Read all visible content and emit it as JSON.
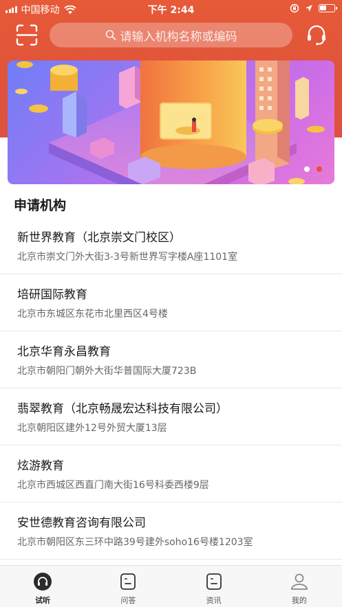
{
  "status_bar": {
    "carrier": "中国移动",
    "time": "下午 2:44"
  },
  "header": {
    "search": {
      "placeholder": "请输入机构名称或编码"
    }
  },
  "colors": {
    "accent": "#e25336",
    "header_bg": "#e0533a"
  },
  "banner": {
    "slide_count": 2,
    "active_slide": 1
  },
  "section": {
    "title": "申请机构"
  },
  "organizations": [
    {
      "name": "新世界教育（北京崇文门校区）",
      "address": "北京市崇文门外大街3-3号新世界写字楼A座1101室"
    },
    {
      "name": "培研国际教育",
      "address": "北京市东城区东花市北里西区4号楼"
    },
    {
      "name": "北京华育永昌教育",
      "address": "北京市朝阳门朝外大街华普国际大厦723B"
    },
    {
      "name": "翡翠教育（北京畅晟宏达科技有限公司）",
      "address": "北京朝阳区建外12号外贸大厦13层"
    },
    {
      "name": "炫游教育",
      "address": "北京市西城区西直门南大街16号科委西楼9层"
    },
    {
      "name": "安世德教育咨询有限公司",
      "address": "北京市朝阳区东三环中路39号建外soho16号楼1203室"
    }
  ],
  "tabs": [
    {
      "label": "试听",
      "icon": "headphones-icon",
      "active": true
    },
    {
      "label": "问答",
      "icon": "qa-icon",
      "active": false
    },
    {
      "label": "资讯",
      "icon": "news-icon",
      "active": false
    },
    {
      "label": "我的",
      "icon": "person-icon",
      "active": false
    }
  ]
}
